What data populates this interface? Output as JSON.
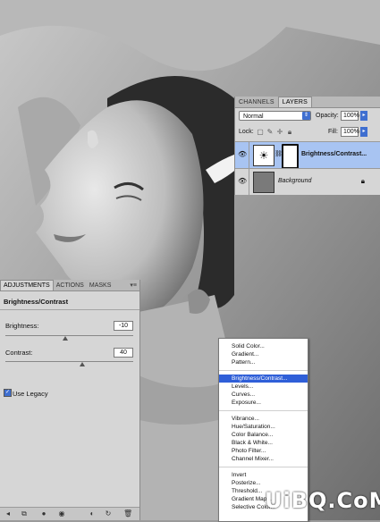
{
  "layers_panel": {
    "tabs": [
      "CHANNELS",
      "LAYERS"
    ],
    "blend_mode": "Normal",
    "opacity_label": "Opacity:",
    "opacity_value": "100%",
    "lock_label": "Lock:",
    "fill_label": "Fill:",
    "fill_value": "100%",
    "layers": [
      {
        "name": "Brightness/Contrast...",
        "selected": true
      },
      {
        "name": "Background",
        "selected": false
      }
    ]
  },
  "adjustments_panel": {
    "tabs": [
      "ADJUSTMENTS",
      "ACTIONS",
      "MASKS"
    ],
    "title": "Brightness/Contrast",
    "brightness_label": "Brightness:",
    "brightness_value": "-10",
    "contrast_label": "Contrast:",
    "contrast_value": "40",
    "use_legacy_label": "Use Legacy",
    "use_legacy_checked": true,
    "brightness_slider_level": -10,
    "contrast_slider_level": 40
  },
  "adjustment_menu": {
    "groups": [
      [
        "Solid Color...",
        "Gradient...",
        "Pattern..."
      ],
      [
        "Brightness/Contrast...",
        "Levels...",
        "Curves...",
        "Exposure..."
      ],
      [
        "Vibrance...",
        "Hue/Saturation...",
        "Color Balance...",
        "Black & White...",
        "Photo Filter...",
        "Channel Mixer..."
      ],
      [
        "Invert",
        "Posterize...",
        "Threshold...",
        "Gradient Map...",
        "Selective Color..."
      ]
    ],
    "highlighted": "Brightness/Contrast..."
  },
  "watermark": "UiBQ.CoM",
  "colors": {
    "highlight": "#2f5fd8",
    "selected_layer": "#a8c4f2"
  }
}
